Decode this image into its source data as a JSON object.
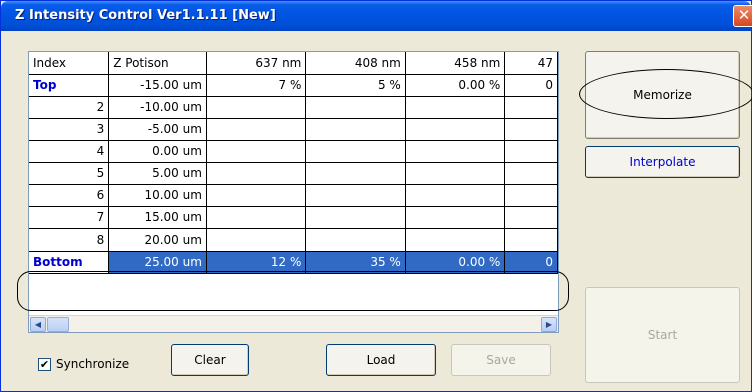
{
  "window": {
    "title": "Z Intensity Control Ver1.1.11 [New]",
    "close_glyph": "✕"
  },
  "grid": {
    "headers": [
      "Index",
      "Z Potison",
      "637  nm",
      "408  nm",
      "458  nm",
      "47"
    ],
    "rows": [
      {
        "index": "Top",
        "z": "-15.00  um",
        "c637": "7 %",
        "c408": "5 %",
        "c458": "0.00 %",
        "c47": "0"
      },
      {
        "index": "2",
        "z": "-10.00  um",
        "c637": "",
        "c408": "",
        "c458": "",
        "c47": ""
      },
      {
        "index": "3",
        "z": "-5.00  um",
        "c637": "",
        "c408": "",
        "c458": "",
        "c47": ""
      },
      {
        "index": "4",
        "z": "0.00  um",
        "c637": "",
        "c408": "",
        "c458": "",
        "c47": ""
      },
      {
        "index": "5",
        "z": "5.00  um",
        "c637": "",
        "c408": "",
        "c458": "",
        "c47": ""
      },
      {
        "index": "6",
        "z": "10.00  um",
        "c637": "",
        "c408": "",
        "c458": "",
        "c47": ""
      },
      {
        "index": "7",
        "z": "15.00  um",
        "c637": "",
        "c408": "",
        "c458": "",
        "c47": ""
      },
      {
        "index": "8",
        "z": "20.00  um",
        "c637": "",
        "c408": "",
        "c458": "",
        "c47": ""
      },
      {
        "index": "Bottom",
        "z": "25.00  um",
        "c637": "12 %",
        "c408": "35 %",
        "c458": "0.00 %",
        "c47": "0"
      }
    ],
    "scroll_left": "◀",
    "scroll_right": "▶"
  },
  "buttons": {
    "memorize": "Memorize",
    "interpolate": "Interpolate",
    "start": "Start",
    "clear": "Clear",
    "load": "Load",
    "save": "Save"
  },
  "synchronize": {
    "label": "Synchronize",
    "checked": true,
    "check_glyph": "✔"
  },
  "colors": {
    "title_bar": "#0054e3",
    "selection": "#316ac5",
    "label_blue": "#0000cc"
  }
}
